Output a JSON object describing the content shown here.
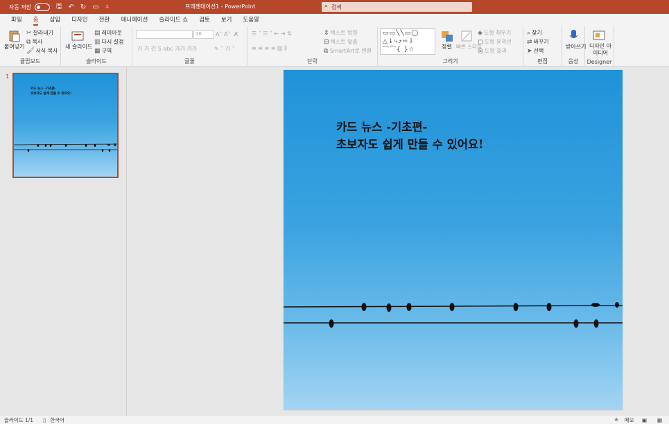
{
  "titlebar": {
    "autosave_label": "자동 저장",
    "doc_title": "프레젠테이션1 - PowerPoint",
    "search_placeholder": "검색"
  },
  "tabs": [
    "파일",
    "홈",
    "삽입",
    "디자인",
    "전환",
    "애니메이션",
    "슬라이드 쇼",
    "검토",
    "보기",
    "도움말"
  ],
  "active_tab": "홈",
  "ribbon": {
    "clipboard": {
      "paste": "붙여넣기",
      "cut": "잘라내기",
      "copy": "복사",
      "format_painter": "서식 복사",
      "label": "클립보드"
    },
    "slides": {
      "new_slide": "새 슬라이드",
      "layout": "레이아웃",
      "reset": "다시 설정",
      "section": "구역",
      "label": "슬라이드"
    },
    "font": {
      "size": "36",
      "label": "글꼴"
    },
    "paragraph": {
      "text_direction": "텍스트 방향",
      "align_text": "텍스트 맞춤",
      "smartart": "SmartArt로 변환",
      "label": "단락"
    },
    "drawing": {
      "arrange": "정렬",
      "quick_styles": "빠른 스타일",
      "shape_fill": "도형 채우기",
      "shape_outline": "도형 윤곽선",
      "shape_effects": "도형 효과",
      "label": "그리기"
    },
    "editing": {
      "find": "찾기",
      "replace": "바꾸기",
      "select": "선택",
      "label": "편집"
    },
    "voice": {
      "dictate": "받아쓰기",
      "label": "음성"
    },
    "designer": {
      "design_ideas": "디자인 아이디어",
      "label": "Designer"
    }
  },
  "slides_panel": {
    "slide_number": "1"
  },
  "slide": {
    "title_line1": "카드 뉴스 -기초편-",
    "title_line2": "초보자도 쉽게 만들 수 있어요!"
  },
  "statusbar": {
    "slide_count": "슬라이드 1/1",
    "language": "한국어",
    "notes": "메모"
  },
  "colors": {
    "accent": "#b7472a",
    "sky_top": "#1f93d8",
    "sky_bottom": "#a3d4f2"
  }
}
